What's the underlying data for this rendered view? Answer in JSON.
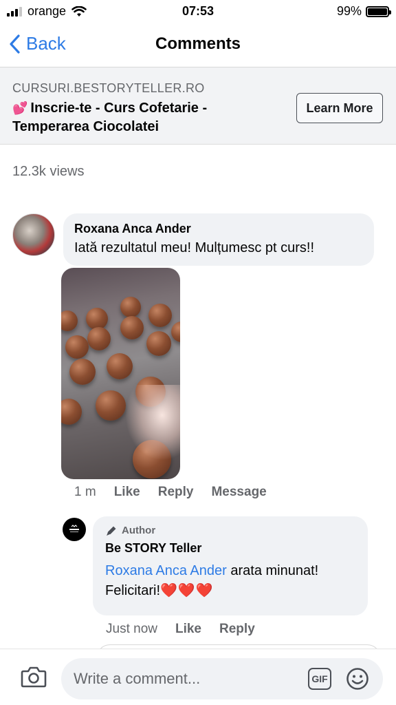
{
  "status": {
    "carrier": "orange",
    "time": "07:53",
    "battery": "99%"
  },
  "nav": {
    "back_label": "Back",
    "title": "Comments"
  },
  "ad": {
    "domain": "CURSURI.BESTORYTELLER.RO",
    "emoji": "💕",
    "title": "Inscrie-te - Curs Cofetarie - Temperarea Ciocolatei",
    "button_label": "Learn More"
  },
  "post": {
    "views": "12.3k views"
  },
  "comment": {
    "author": "Roxana Anca Ander",
    "text": "Iată rezultatul meu! Mulțumesc pt curs!!",
    "time": "1 m",
    "like_label": "Like",
    "reply_label": "Reply",
    "message_label": "Message"
  },
  "reply": {
    "badge": "Author",
    "author": "Be STORY Teller",
    "mention": "Roxana Anca Ander",
    "text_after_mention": " arata minunat!",
    "line2": "Felicitari!",
    "hearts": "❤️❤️❤️",
    "time": "Just now",
    "like_label": "Like",
    "reply_label": "Reply"
  },
  "composer": {
    "placeholder": "Write a comment...",
    "gif_label": "GIF"
  },
  "colors": {
    "accent": "#2d7be5",
    "bubble": "#f0f2f5",
    "muted": "#65676b"
  }
}
